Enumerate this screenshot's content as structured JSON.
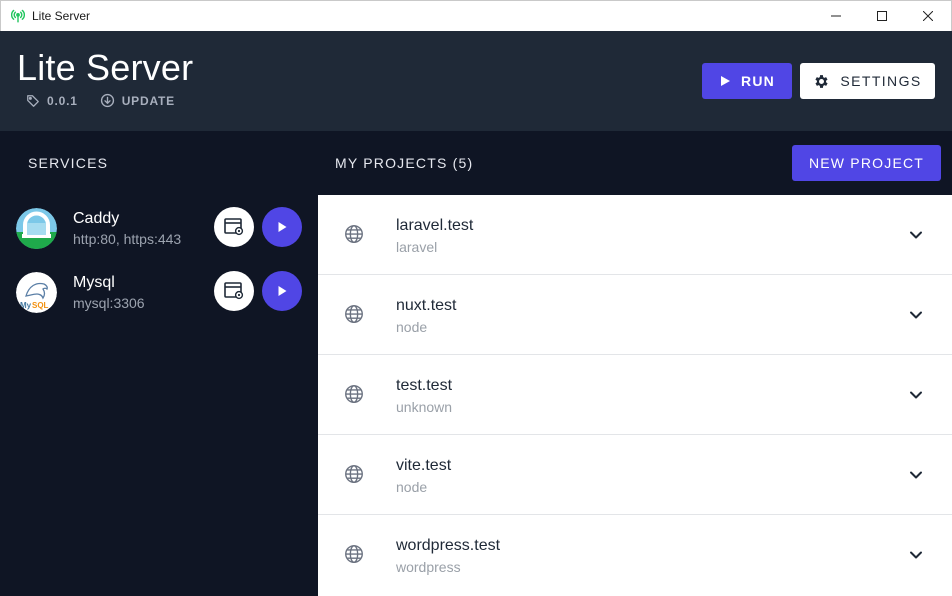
{
  "window": {
    "title": "Lite Server"
  },
  "header": {
    "app_title": "Lite Server",
    "version": "0.0.1",
    "update_label": "UPDATE",
    "run_label": "RUN",
    "settings_label": "SETTINGS"
  },
  "services": {
    "title": "SERVICES",
    "items": [
      {
        "name": "Caddy",
        "detail": "http:80, https:443",
        "icon": "caddy-logo"
      },
      {
        "name": "Mysql",
        "detail": "mysql:3306",
        "icon": "mysql-logo"
      }
    ]
  },
  "projects": {
    "title": "MY PROJECTS (5)",
    "new_label": "NEW PROJECT",
    "items": [
      {
        "name": "laravel.test",
        "type": "laravel"
      },
      {
        "name": "nuxt.test",
        "type": "node"
      },
      {
        "name": "test.test",
        "type": "unknown"
      },
      {
        "name": "vite.test",
        "type": "node"
      },
      {
        "name": "wordpress.test",
        "type": "wordpress"
      }
    ]
  },
  "colors": {
    "accent": "#5046e5",
    "header_bg": "#1f2937",
    "body_bg": "#0f1524",
    "app_icon": "#22c55e"
  }
}
